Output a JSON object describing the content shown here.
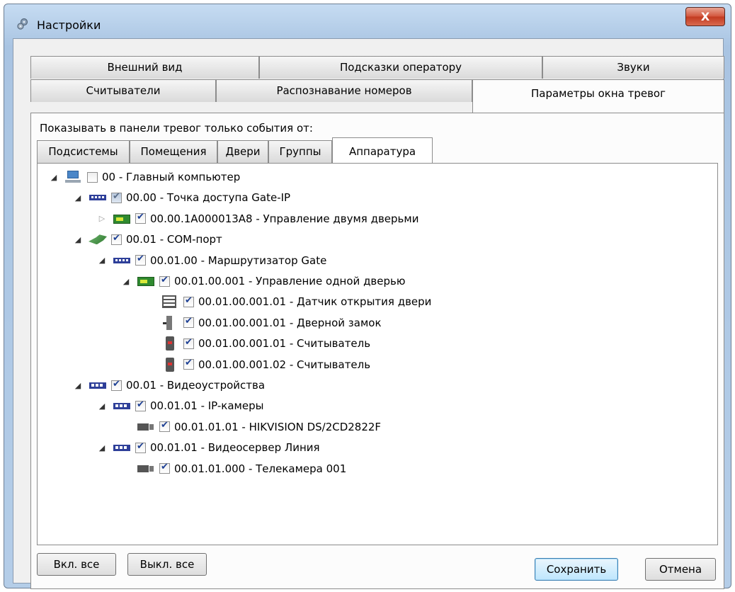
{
  "window": {
    "title": "Настройки",
    "close_label": "X"
  },
  "tabs_row1": [
    {
      "label": "Внешний вид"
    },
    {
      "label": "Подсказки оператору"
    },
    {
      "label": "Звуки"
    }
  ],
  "tabs_row2": [
    {
      "label": "Считыватели"
    },
    {
      "label": "Распознавание номеров"
    },
    {
      "label": "Параметры окна тревог",
      "active": true
    }
  ],
  "panel": {
    "caption": "Показывать в панели тревог только события от:",
    "subtabs": [
      {
        "label": "Подсистемы"
      },
      {
        "label": "Помещения"
      },
      {
        "label": "Двери"
      },
      {
        "label": "Группы"
      },
      {
        "label": "Аппаратура",
        "active": true
      }
    ]
  },
  "tree": [
    {
      "label": "00 - Главный компьютер",
      "icon": "computer-icon",
      "expander": "expanded",
      "check": "unchecked",
      "depth": 0
    },
    {
      "label": "00.00 - Точка доступа Gate-IP",
      "icon": "access-point-icon",
      "expander": "expanded",
      "check": "indeterminate",
      "depth": 1
    },
    {
      "label": "00.00.1A000013A8 - Управление двумя дверьми",
      "icon": "controller-board-icon",
      "expander": "collapsed",
      "check": "checked",
      "depth": 2
    },
    {
      "label": "00.01 - COM-порт",
      "icon": "com-port-icon",
      "expander": "expanded",
      "check": "checked",
      "depth": 1
    },
    {
      "label": "00.01.00 - Маршрутизатор Gate",
      "icon": "router-icon",
      "expander": "expanded",
      "check": "checked",
      "depth": 2
    },
    {
      "label": "00.01.00.001 - Управление одной дверью",
      "icon": "controller-board-icon",
      "expander": "expanded",
      "check": "checked",
      "depth": 3
    },
    {
      "label": "00.01.00.001.01 - Датчик открытия двери",
      "icon": "door-sensor-icon",
      "expander": "none",
      "check": "checked",
      "depth": 4
    },
    {
      "label": "00.01.00.001.01 - Дверной замок",
      "icon": "door-lock-icon",
      "expander": "none",
      "check": "checked",
      "depth": 4
    },
    {
      "label": "00.01.00.001.01 - Считыватель",
      "icon": "card-reader-icon",
      "expander": "none",
      "check": "checked",
      "depth": 4
    },
    {
      "label": "00.01.00.001.02 - Считыватель",
      "icon": "card-reader-icon",
      "expander": "none",
      "check": "checked",
      "depth": 4
    },
    {
      "label": "00.01 - Видеоустройства",
      "icon": "video-devices-icon",
      "expander": "expanded",
      "check": "checked",
      "depth": 1
    },
    {
      "label": "00.01.01 - IP-камеры",
      "icon": "video-devices-icon",
      "expander": "expanded",
      "check": "checked",
      "depth": 2
    },
    {
      "label": "00.01.01.01 - HIKVISION DS/2CD2822F",
      "icon": "camera-icon",
      "expander": "none",
      "check": "checked",
      "depth": 3
    },
    {
      "label": "00.01.01 - Видеосервер Линия",
      "icon": "video-devices-icon",
      "expander": "expanded",
      "check": "checked",
      "depth": 2
    },
    {
      "label": "00.01.01.000 - Телекамера 001",
      "icon": "camera-icon",
      "expander": "none",
      "check": "checked",
      "depth": 3
    }
  ],
  "buttons": {
    "enable_all": "Вкл. все",
    "disable_all": "Выкл. все",
    "save": "Сохранить",
    "cancel": "Отмена"
  }
}
